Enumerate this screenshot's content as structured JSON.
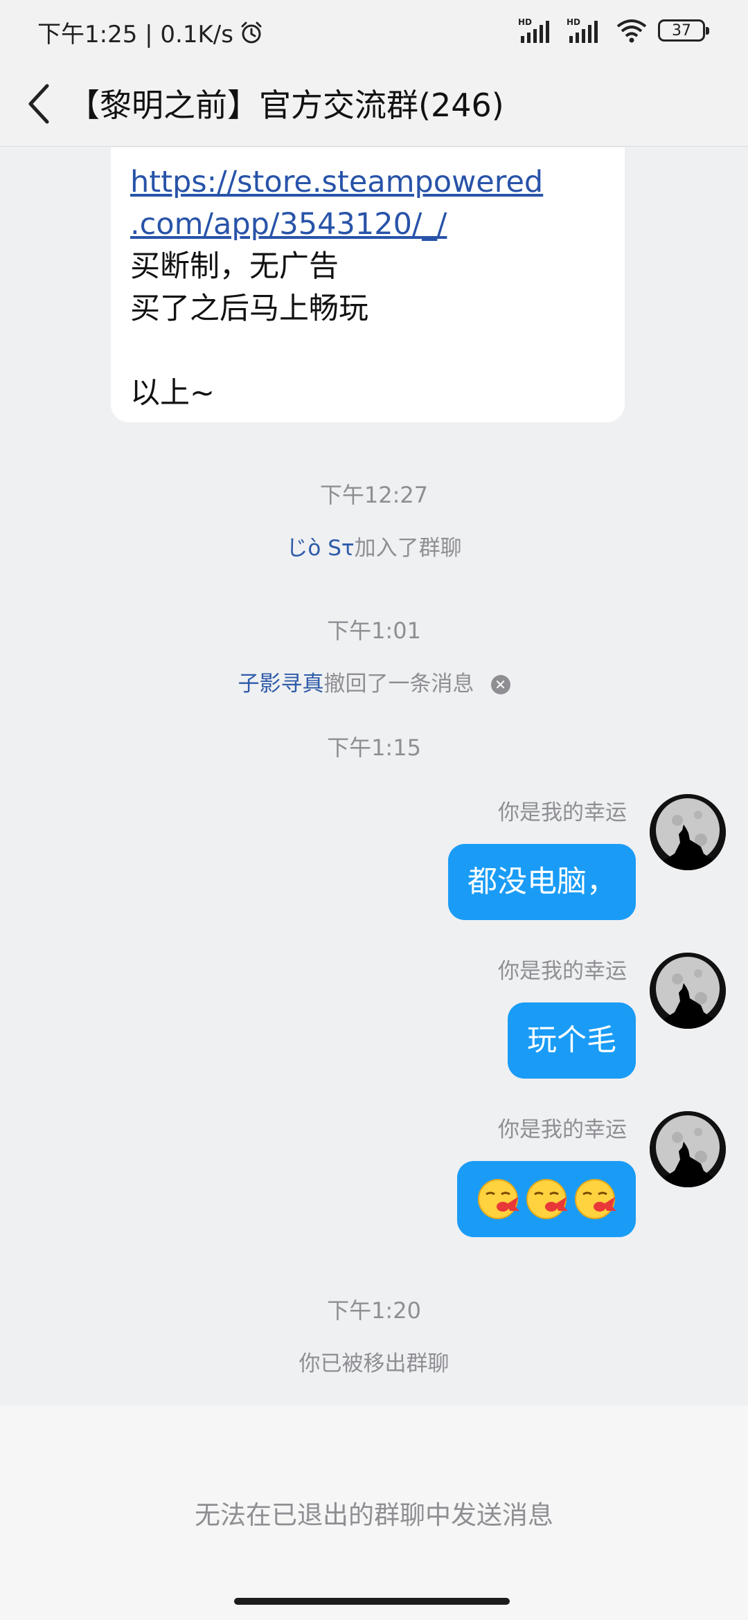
{
  "status_bar": {
    "time_speed": "下午1:25 | 0.1K/s",
    "network_1": "HD",
    "network_2": "HD",
    "battery": "37"
  },
  "header": {
    "title": "【黎明之前】官方交流群(246)"
  },
  "messages": {
    "received": {
      "link_line1": "https://store.steampowered",
      "link_line2": ".com/app/3543120/_/",
      "line1": "买断制，无广告",
      "line2": "买了之后马上畅玩",
      "line3": "以上~"
    },
    "time1": "下午12:27",
    "join_name": "じò Sτ",
    "join_text": "加入了群聊",
    "time2": "下午1:01",
    "recall_name": "子影寻真",
    "recall_text": "撤回了一条消息",
    "time3": "下午1:15",
    "sender": "你是我的幸运",
    "sent1": "都没电脑，",
    "sent2": "玩个毛",
    "time4": "下午1:20",
    "removed": "你已被移出群聊"
  },
  "bottom": {
    "disabled_text": "无法在已退出的群聊中发送消息"
  },
  "colors": {
    "accent_blue": "#1a9cf6",
    "link_blue": "#2853a8",
    "background": "#eff0f2"
  }
}
